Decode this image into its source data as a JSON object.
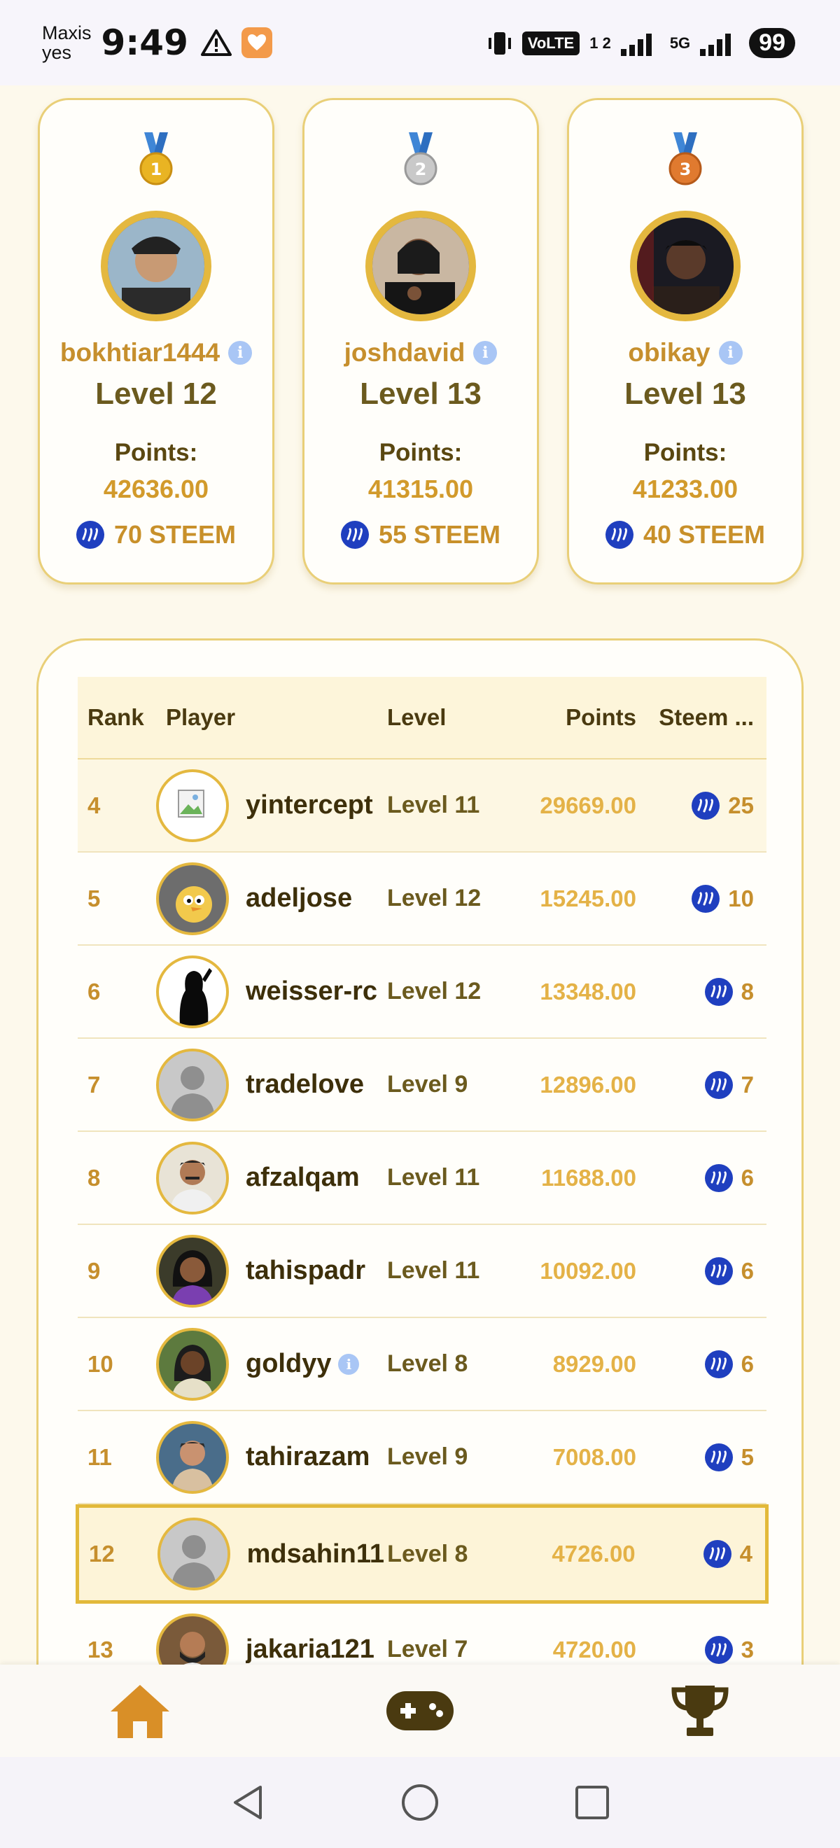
{
  "status_bar": {
    "carrier_line1": "Maxis",
    "carrier_line2": "yes",
    "time": "9:49",
    "network_badge": "VoLTE",
    "network_sub": "1 2",
    "network_5g": "5G",
    "battery": "99"
  },
  "podium": [
    {
      "rank_medal": "1",
      "username": "bokhtiar1444",
      "level": "Level 12",
      "points_label": "Points:",
      "points": "42636.00",
      "reward": "70 STEEM",
      "medal_color": "#e9b423"
    },
    {
      "rank_medal": "2",
      "username": "joshdavid",
      "level": "Level 13",
      "points_label": "Points:",
      "points": "41315.00",
      "reward": "55 STEEM",
      "medal_color": "#b8b8b8"
    },
    {
      "rank_medal": "3",
      "username": "obikay",
      "level": "Level 13",
      "points_label": "Points:",
      "points": "41233.00",
      "reward": "40 STEEM",
      "medal_color": "#e07a2f"
    }
  ],
  "table": {
    "headers": {
      "rank": "Rank",
      "player": "Player",
      "level": "Level",
      "points": "Points",
      "steem": "Steem ..."
    },
    "rows": [
      {
        "rank": "4",
        "username": "yintercept",
        "level": "Level 11",
        "points": "29669.00",
        "steem": "25"
      },
      {
        "rank": "5",
        "username": "adeljose",
        "level": "Level 12",
        "points": "15245.00",
        "steem": "10"
      },
      {
        "rank": "6",
        "username": "weisser-rc",
        "level": "Level 12",
        "points": "13348.00",
        "steem": "8"
      },
      {
        "rank": "7",
        "username": "tradelove",
        "level": "Level 9",
        "points": "12896.00",
        "steem": "7"
      },
      {
        "rank": "8",
        "username": "afzalqam",
        "level": "Level 11",
        "points": "11688.00",
        "steem": "6"
      },
      {
        "rank": "9",
        "username": "tahispadr",
        "level": "Level 11",
        "points": "10092.00",
        "steem": "6"
      },
      {
        "rank": "10",
        "username": "goldyy",
        "level": "Level 8",
        "points": "8929.00",
        "steem": "6"
      },
      {
        "rank": "11",
        "username": "tahirazam",
        "level": "Level 9",
        "points": "7008.00",
        "steem": "5"
      },
      {
        "rank": "12",
        "username": "mdsahin11",
        "level": "Level 8",
        "points": "4726.00",
        "steem": "4"
      },
      {
        "rank": "13",
        "username": "jakaria121",
        "level": "Level 7",
        "points": "4720.00",
        "steem": "3"
      }
    ]
  },
  "bottom_nav": [
    "home-icon",
    "gamepad-icon",
    "trophy-icon"
  ],
  "colors": {
    "accent_gold": "#e4b83f",
    "text_brown": "#4a3a10",
    "steem_blue": "#1f3fbf",
    "nav_brown": "#4a3a10",
    "home_orange": "#d98f27"
  }
}
